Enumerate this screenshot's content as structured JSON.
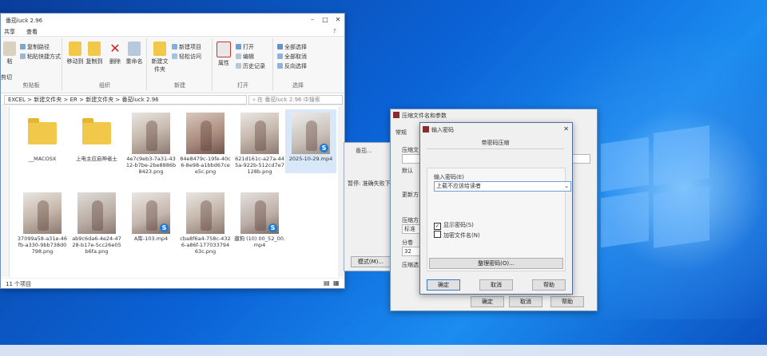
{
  "explorer": {
    "title": "番茄luck 2.96",
    "menu": [
      "共享",
      "查看"
    ],
    "ribbon": {
      "group1": {
        "items": [
          "复制路径",
          "粘贴快捷方式"
        ],
        "big": [
          "粘",
          "剪切"
        ],
        "label": "剪贴板"
      },
      "group2": {
        "big": [
          "移动到",
          "复制到",
          "删除",
          "重命名"
        ],
        "label": "组织"
      },
      "group3": {
        "big": "新建文件夹",
        "items": [
          "新建项目",
          "轻松访问"
        ],
        "label": "新建"
      },
      "group4": {
        "big": "属性",
        "items": [
          "打开",
          "编辑",
          "历史记录"
        ],
        "label": "打开"
      },
      "group5": {
        "items": [
          "全部选择",
          "全部取消",
          "反向选择"
        ],
        "label": "选择"
      }
    },
    "address": [
      "EXCEL",
      "新建文件夹",
      "ER",
      "新建文件夹",
      "番茄luck 2.96"
    ],
    "search_placeholder": "在 番茄luck 2.96 中搜索",
    "files": [
      {
        "name": "__MACOSX",
        "kind": "folder"
      },
      {
        "name": "上电主应启神者土",
        "kind": "folder"
      },
      {
        "name": "4e7c9eb3-7a31-4312-b7be-2be8886b8423.png",
        "kind": "image"
      },
      {
        "name": "84e8479c-19fe-40c6-8e98-a1bbd67cee5c.png",
        "kind": "image"
      },
      {
        "name": "621d161c-a27a-445a-922b-512cd7e7128b.png",
        "kind": "image"
      },
      {
        "name": "2025-10-29.mp4",
        "kind": "video"
      },
      {
        "name": "37099a58-a31e-46fb-a330-9bb738d0798.png",
        "kind": "image"
      },
      {
        "name": "ab9c6da6-4e24-4728-b17e-5cc26e05b6fa.png",
        "kind": "image"
      },
      {
        "name": "A库-103.mp4",
        "kind": "video"
      },
      {
        "name": "cba8f6a4-758c-4326-a86f-17703379463c.png",
        "kind": "image"
      },
      {
        "name": "遛狗 (10) 00_52_00.mp4",
        "kind": "video"
      }
    ],
    "status": "11 个项目"
  },
  "bg_dialog": {
    "title": "番茄...",
    "text": "暂停: 准确失败下价",
    "button": "模式(M)..."
  },
  "params": {
    "title": "压缩文件名和参数",
    "tab": "常规",
    "labels": {
      "name": "压缩文",
      "profile": "默认",
      "update": "更新方",
      "format": "压缩方",
      "format_sel": "标准",
      "split": "分卷",
      "split_val": "32",
      "opt": "压缩选"
    },
    "buttons": {
      "ok": "确定",
      "cancel": "取消",
      "help": "帮助"
    }
  },
  "password": {
    "title": "输入密码",
    "tab": "带密码压缩",
    "label": "输入密码(E)",
    "value": "上载不应该给读者",
    "show_password": "显示密码(S)",
    "encrypt_names": "加密文件名(N)",
    "show_checked": true,
    "encrypt_checked": false,
    "manage": "整理密码(O)...",
    "buttons": {
      "ok": "确定",
      "cancel": "取消",
      "help": "帮助"
    }
  }
}
